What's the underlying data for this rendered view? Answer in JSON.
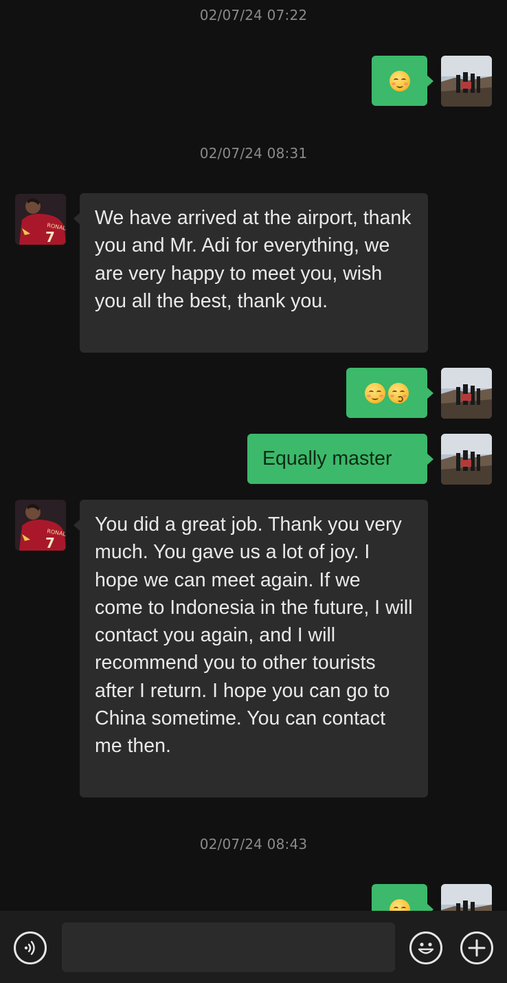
{
  "timestamps": [
    "02/07/24 07:22",
    "02/07/24 08:31",
    "02/07/24 08:43"
  ],
  "messages": [
    {
      "side": "right",
      "emojis": [
        "smiling-face-icon"
      ]
    },
    {
      "side": "left",
      "text": "We have arrived at the airport, thank you and Mr. Adi for everything, we are very happy to meet you, wish you all the best, thank you."
    },
    {
      "side": "right",
      "emojis": [
        "smiling-face-icon",
        "kissing-face-icon"
      ]
    },
    {
      "side": "right",
      "text": "Equally master"
    },
    {
      "side": "left",
      "text": "You did a great job. Thank you very much. You gave us a lot of joy. I hope we can meet again. If we come to Indonesia in the future, I will contact you again, and I will recommend you to other tourists after I return. I hope you can go to China sometime. You can contact me then."
    },
    {
      "side": "right",
      "emojis": [
        "smiling-face-icon"
      ]
    }
  ],
  "contact_avatar": {
    "jersey_name": "RONALDO",
    "jersey_number": "7"
  },
  "colors": {
    "background": "#111111",
    "sent_bubble": "#3cb96a",
    "received_bubble": "#2c2c2c",
    "timestamp": "#8a8a8a"
  },
  "bottom_bar": {
    "voice_icon": "voice-input-icon",
    "emoji_icon": "emoji-picker-icon",
    "more_icon": "plus-icon"
  }
}
